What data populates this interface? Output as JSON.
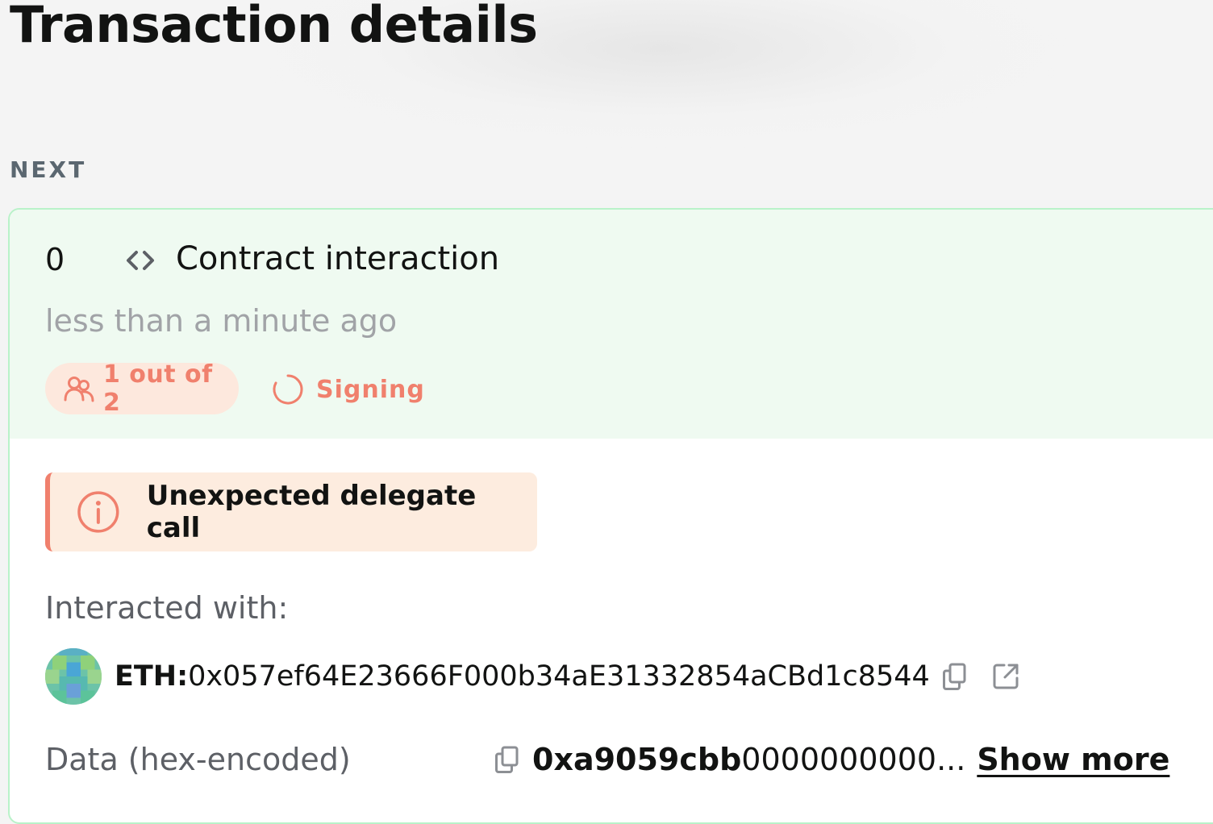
{
  "page": {
    "title": "Transaction details"
  },
  "queue": {
    "section_label": "NEXT"
  },
  "transaction": {
    "nonce": "0",
    "type_icon": "code-icon",
    "type": "Contract interaction",
    "time": "less than a minute ago",
    "confirmations": {
      "icon": "people-icon",
      "label": "1 out of 2"
    },
    "status": {
      "icon": "spinner-icon",
      "label": "Signing"
    }
  },
  "warning": {
    "icon": "info-icon",
    "text": "Unexpected delegate call"
  },
  "details": {
    "interacted_label": "Interacted with:",
    "chain_prefix": "ETH:",
    "address": "0x057ef64E23666F000b34aE31332854aCBd1c8544",
    "data_label": "Data (hex-encoded)",
    "data_prefix": "0xa9059cbb",
    "data_rest": "0000000000...",
    "show_more": "Show more"
  },
  "colors": {
    "accent_warning": "#f0806d",
    "header_bg": "#effaf1",
    "card_border": "#b9f2c9",
    "warning_bg": "#fdecdf"
  }
}
